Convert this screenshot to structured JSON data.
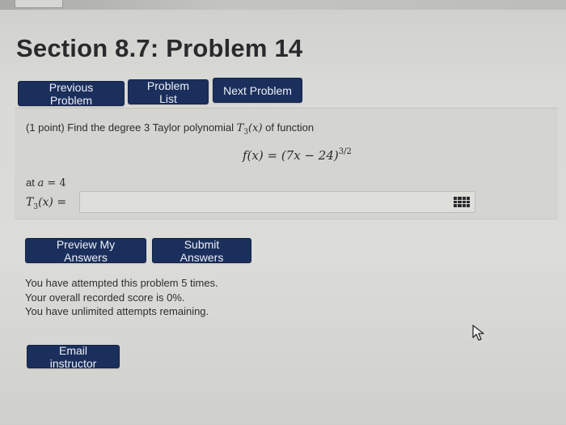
{
  "header": {
    "title": "Section 8.7: Problem 14"
  },
  "nav": {
    "previous_label": "Previous Problem",
    "list_label": "Problem List",
    "next_label": "Next Problem"
  },
  "problem": {
    "prompt_prefix": "(1 point) Find the degree 3 Taylor polynomial ",
    "prompt_poly": "T",
    "prompt_poly_sub": "3",
    "prompt_poly_arg": "(x)",
    "prompt_suffix": " of function",
    "formula_lhs": "f(x) = (7x − 24)",
    "formula_exp": "3/2",
    "at_label": "at ",
    "at_var": "a",
    "at_eq": " = 4",
    "answer_label_poly": "T",
    "answer_label_sub": "3",
    "answer_label_rest": "(x) =",
    "answer_value": ""
  },
  "actions": {
    "preview_label": "Preview My Answers",
    "submit_label": "Submit Answers"
  },
  "status": {
    "attempts": "You have attempted this problem 5 times.",
    "score": "Your overall recorded score is 0%.",
    "remaining": "You have unlimited attempts remaining."
  },
  "footer": {
    "email_label": "Email instructor"
  },
  "icons": {
    "equation_editor": "grid-icon",
    "pointer": "mouse-cursor-icon"
  },
  "colors": {
    "button_bg": "#1b2f5c",
    "button_text": "#eef1f7",
    "page_bg": "#d9d9d6"
  }
}
